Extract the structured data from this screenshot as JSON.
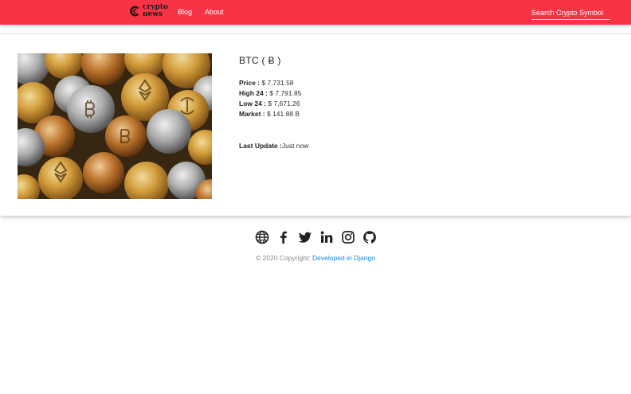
{
  "navbar": {
    "brand_line1": "crypto",
    "brand_line2": "news",
    "links": [
      {
        "label": "Blog"
      },
      {
        "label": "About"
      }
    ],
    "search_placeholder": "Search Crypto Symbol"
  },
  "coin": {
    "title": "BTC ( Ƀ )",
    "price_label": "Price :",
    "price_value": " $ 7,731.58",
    "high_label": "High 24 :",
    "high_value": " $ 7,791.85",
    "low_label": "Low 24 :",
    "low_value": " $ 7,671.26",
    "market_label": "Market :",
    "market_value": " $ 141.88 B",
    "update_label": "Last Update :",
    "update_value": "Just now"
  },
  "footer": {
    "social_icons": [
      "globe-icon",
      "facebook-icon",
      "twitter-icon",
      "linkedin-icon",
      "instagram-icon",
      "github-icon"
    ],
    "copyright": "© 2020 Copyright: ",
    "link_text": "Developed in Django"
  },
  "colors": {
    "navbar": "#f73446",
    "link": "#1e88e5",
    "icon": "#222222"
  }
}
